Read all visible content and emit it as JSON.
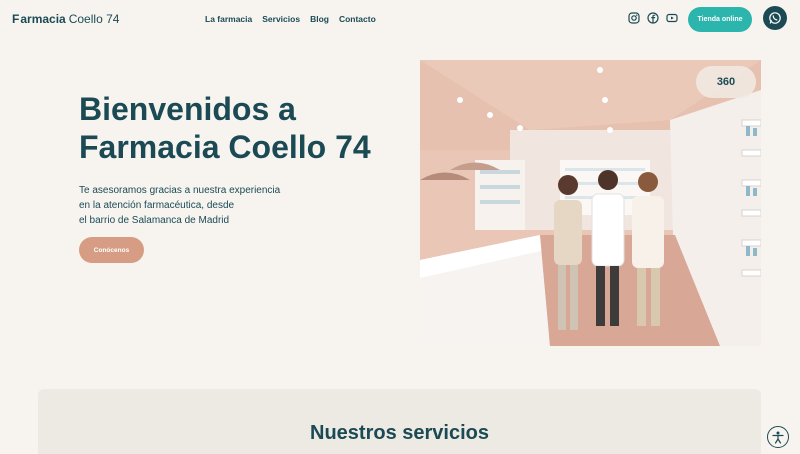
{
  "header": {
    "logo_prefix": "F",
    "logo_bold": "armacia",
    "logo_light": "Coello 74",
    "nav": [
      "La farmacia",
      "Servicios",
      "Blog",
      "Contacto"
    ],
    "socials": [
      "instagram-icon",
      "facebook-icon",
      "youtube-icon"
    ],
    "shop_label": "Tienda online",
    "whatsapp_icon": "whatsapp-icon"
  },
  "hero": {
    "title_line1": "Bienvenidos a",
    "title_line2": "Farmacia Coello 74",
    "text_line1": "Te asesoramos gracias a nuestra experiencia",
    "text_line2": "en la atención farmacéutica, desde",
    "text_line3": "el barrio de Salamanca de Madrid",
    "cta_label": "Conócenos",
    "badge_360": "360"
  },
  "services": {
    "title": "Nuestros servicios"
  },
  "colors": {
    "primary": "#1b4a54",
    "accent": "#2bb5ad",
    "cta": "#d79d84",
    "background": "#f7f4f0"
  }
}
